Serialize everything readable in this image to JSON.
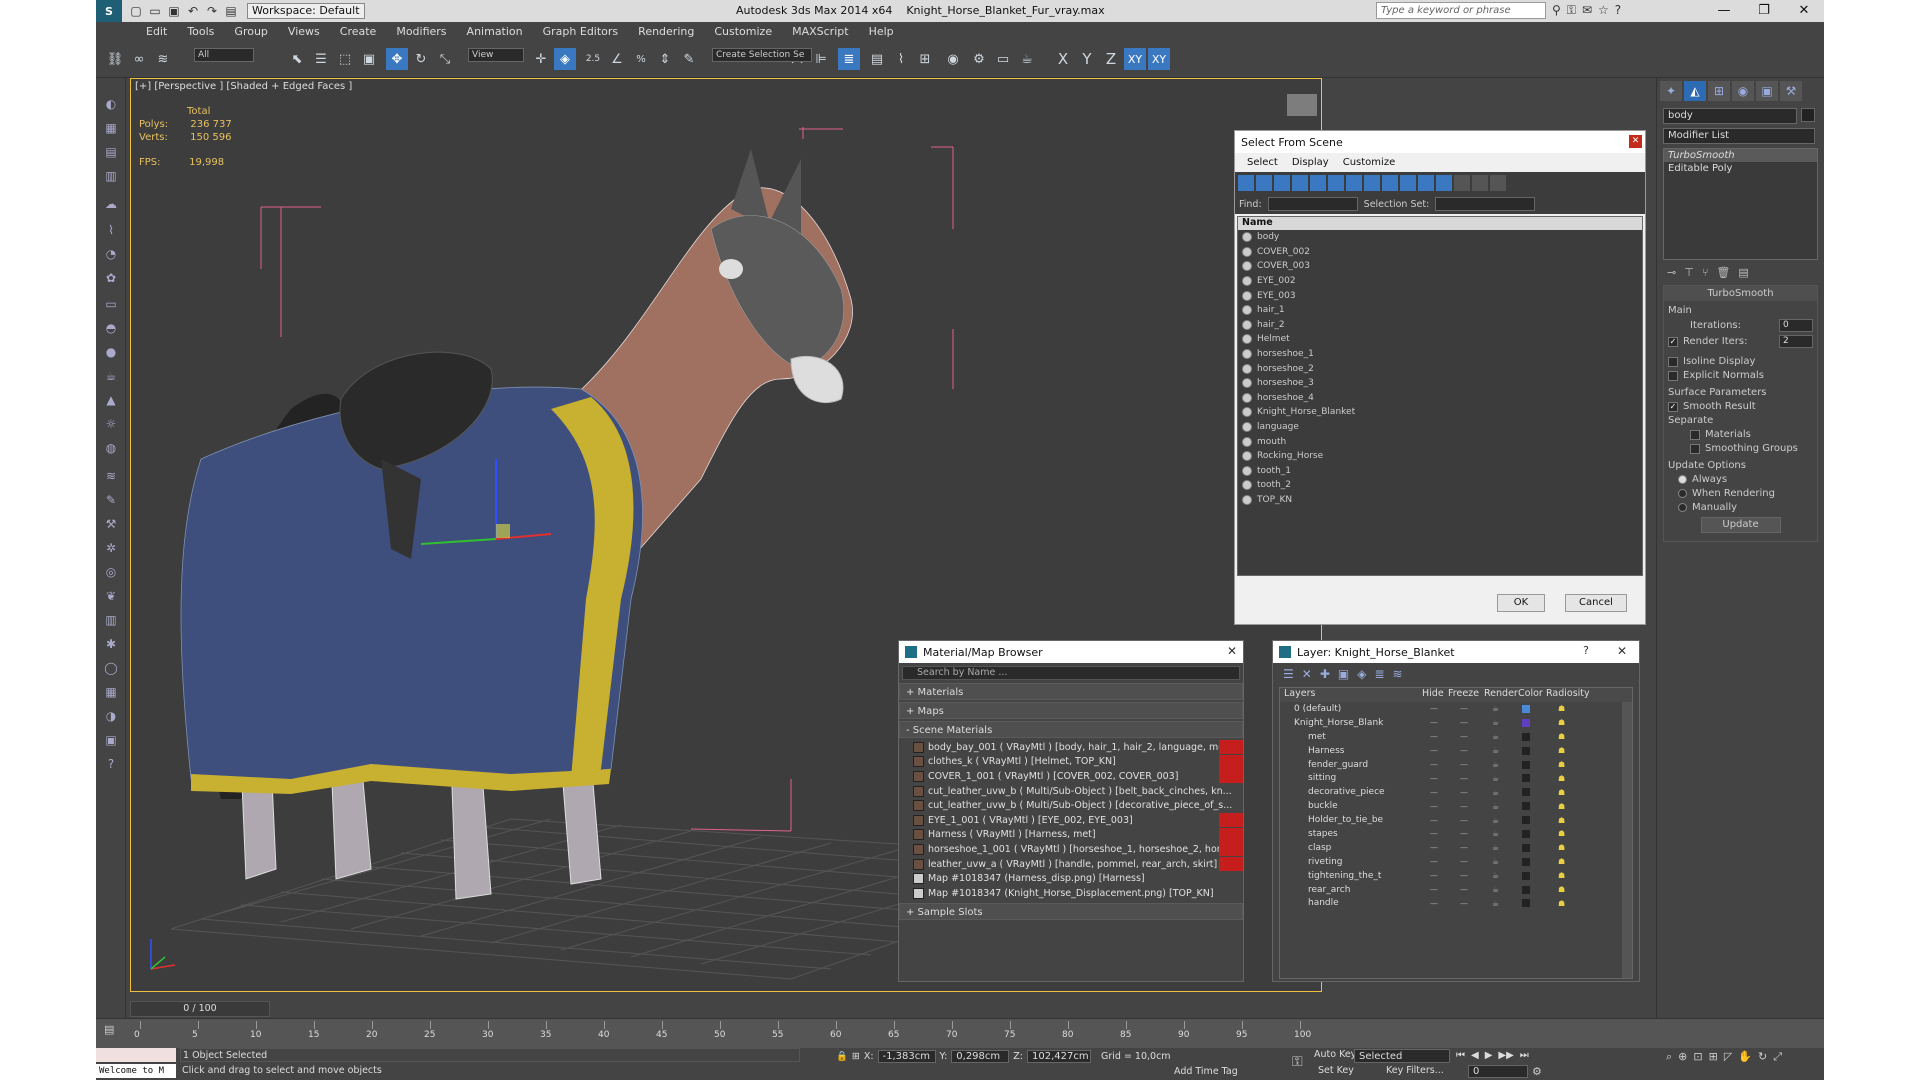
{
  "titlebar": {
    "workspace": "Workspace: Default",
    "app": "Autodesk 3ds Max  2014 x64",
    "file": "Knight_Horse_Blanket_Fur_vray.max",
    "search_placeholder": "Type a keyword or phrase"
  },
  "menu": [
    "Edit",
    "Tools",
    "Group",
    "Views",
    "Create",
    "Modifiers",
    "Animation",
    "Graph Editors",
    "Rendering",
    "Customize",
    "MAXScript",
    "Help"
  ],
  "toolbar": {
    "filter": "All",
    "refcoord": "View",
    "selset": "Create Selection Se",
    "axes": [
      "X",
      "Y",
      "Z",
      "XY",
      "XY"
    ],
    "snaps": [
      "2.5",
      "%"
    ]
  },
  "viewport": {
    "label": "[+] [Perspective ] [Shaded + Edged Faces ]",
    "stats": {
      "total_label": "Total",
      "polys_label": "Polys:",
      "polys": "236 737",
      "verts_label": "Verts:",
      "verts": "150 596",
      "fps_label": "FPS:",
      "fps": "19,998"
    }
  },
  "select_from_scene": {
    "title": "Select From Scene",
    "menu": [
      "Select",
      "Display",
      "Customize"
    ],
    "find_label": "Find:",
    "selset_label": "Selection Set:",
    "col": "Name",
    "items": [
      "body",
      "COVER_002",
      "COVER_003",
      "EYE_002",
      "EYE_003",
      "hair_1",
      "hair_2",
      "Helmet",
      "horseshoe_1",
      "horseshoe_2",
      "horseshoe_3",
      "horseshoe_4",
      "Knight_Horse_Blanket",
      "language",
      "mouth",
      "Rocking_Horse",
      "tooth_1",
      "tooth_2",
      "TOP_KN"
    ],
    "ok": "OK",
    "cancel": "Cancel"
  },
  "material_browser": {
    "title": "Material/Map Browser",
    "search": "Search by Name ...",
    "sections": [
      "+ Materials",
      "+ Maps",
      "- Scene Materials"
    ],
    "items": [
      "body_bay_001  ( VRayMtl ) [body, hair_1, hair_2, language, mo...",
      "clothes_k  ( VRayMtl ) [Helmet, TOP_KN]",
      "COVER_1_001  ( VRayMtl ) [COVER_002, COVER_003]",
      "cut_leather_uvw_b  ( Multi/Sub-Object ) [belt_back_cinches, kn...",
      "cut_leather_uvw_b  ( Multi/Sub-Object ) [decorative_piece_of_s...",
      "EYE_1_001  ( VRayMtl ) [EYE_002, EYE_003]",
      "Harness  ( VRayMtl ) [Harness, met]",
      "horseshoe_1_001  ( VRayMtl ) [horseshoe_1, horseshoe_2, hor...",
      "leather_uvw_a  ( VRayMtl ) [handle, pommel, rear_arch, skirt]",
      "Map #1018347 (Harness_disp.png) [Harness]",
      "Map #1018347 (Knight_Horse_Displacement.png) [TOP_KN]"
    ],
    "sample": "+ Sample Slots"
  },
  "layer": {
    "title": "Layer: Knight_Horse_Blanket",
    "help": "?",
    "cols": [
      "Layers",
      "Hide",
      "Freeze",
      "Render",
      "Color",
      "Radiosity"
    ],
    "rows": [
      "0 (default)",
      "Knight_Horse_Blank",
      "met",
      "Harness",
      "fender_guard",
      "sitting",
      "decorative_piece",
      "buckle",
      "Holder_to_tie_be",
      "stapes",
      "clasp",
      "riveting",
      "tightening_the_t",
      "rear_arch",
      "handle"
    ]
  },
  "cmdpanel": {
    "name": "body",
    "modlist": "Modifier List",
    "stack": [
      "TurboSmooth",
      "Editable Poly"
    ],
    "ts_title": "TurboSmooth",
    "main": "Main",
    "iter_label": "Iterations:",
    "iter": "0",
    "render_iters_label": "Render Iters:",
    "render_iters": "2",
    "isoline": "Isoline Display",
    "explicit": "Explicit Normals",
    "surface": "Surface Parameters",
    "smooth": "Smooth Result",
    "separate": "Separate",
    "materials": "Materials",
    "smoothing": "Smoothing Groups",
    "update_opts": "Update Options",
    "always": "Always",
    "when_rendering": "When Rendering",
    "manually": "Manually",
    "update": "Update"
  },
  "timeline": {
    "frame": "0 / 100",
    "ticks": [
      "0",
      "5",
      "10",
      "15",
      "20",
      "25",
      "30",
      "35",
      "40",
      "45",
      "50",
      "55",
      "60",
      "65",
      "70",
      "75",
      "80",
      "85",
      "90",
      "95",
      "100"
    ]
  },
  "status": {
    "welcome": "Welcome to M",
    "selected": "1 Object Selected",
    "prompt": "Click and drag to select and move objects",
    "x_label": "X:",
    "x": "-1,383cm",
    "y_label": "Y:",
    "y": "0,298cm",
    "z_label": "Z:",
    "z": "102,427cm",
    "grid": "Grid = 10,0cm",
    "add_time_tag": "Add Time Tag",
    "auto_key": "Auto Key",
    "set_key": "Set Key",
    "key_mode": "Selected",
    "key_filters": "Key Filters...",
    "frame_field": "0"
  },
  "colors": {
    "accent": "#3b78c2",
    "close": "#c42b1c",
    "viewport_border": "#f0c040",
    "material_flag": "#c61d1d"
  }
}
